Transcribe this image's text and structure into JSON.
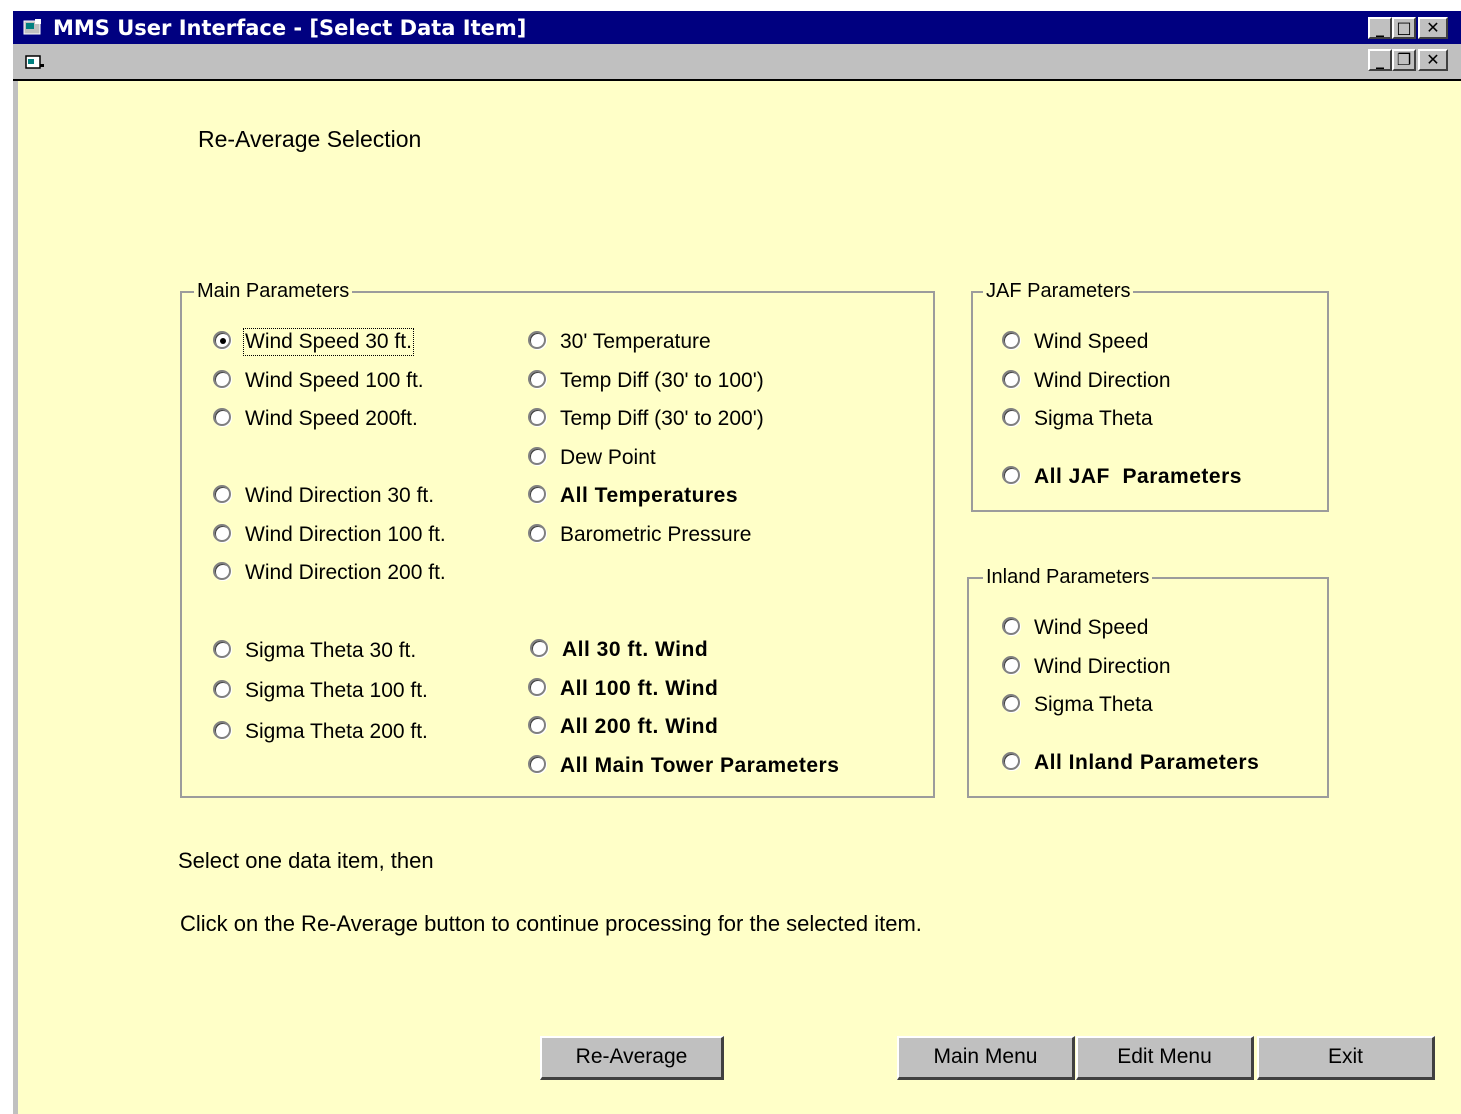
{
  "window": {
    "title": "MMS User Interface - [Select Data Item]"
  },
  "page": {
    "heading": "Re-Average Selection",
    "instruction1": "Select one data item, then",
    "instruction2": "Click on the Re-Average button to continue processing for the selected item."
  },
  "main": {
    "legend": "Main Parameters",
    "col1": [
      "Wind Speed 30 ft.",
      "Wind Speed 100 ft.",
      "Wind Speed 200ft.",
      "Wind Direction 30 ft.",
      "Wind Direction 100 ft.",
      "Wind Direction 200 ft.",
      "Sigma Theta 30 ft.",
      "Sigma Theta 100 ft.",
      "Sigma Theta 200 ft."
    ],
    "col2": [
      "30' Temperature",
      "Temp Diff (30' to 100')",
      "Temp Diff (30' to 200')",
      "Dew Point",
      "All Temperatures",
      "Barometric Pressure",
      "All 30 ft. Wind",
      "All 100 ft. Wind",
      "All 200 ft. Wind",
      "All Main Tower Parameters"
    ],
    "selected": "Wind Speed 30 ft."
  },
  "jaf": {
    "legend": "JAF Parameters",
    "items": [
      "Wind Speed",
      "Wind Direction",
      "Sigma Theta",
      "All JAF  Parameters"
    ]
  },
  "inland": {
    "legend": "Inland Parameters",
    "items": [
      "Wind Speed",
      "Wind Direction",
      "Sigma Theta",
      "All Inland Parameters"
    ]
  },
  "buttons": {
    "reaverage": "Re-Average",
    "main_menu": "Main Menu",
    "edit_menu": "Edit Menu",
    "exit": "Exit"
  },
  "colors": {
    "client_bg": "#ffffc8",
    "titlebar": "#000080",
    "button_face": "#c0c0c0"
  }
}
